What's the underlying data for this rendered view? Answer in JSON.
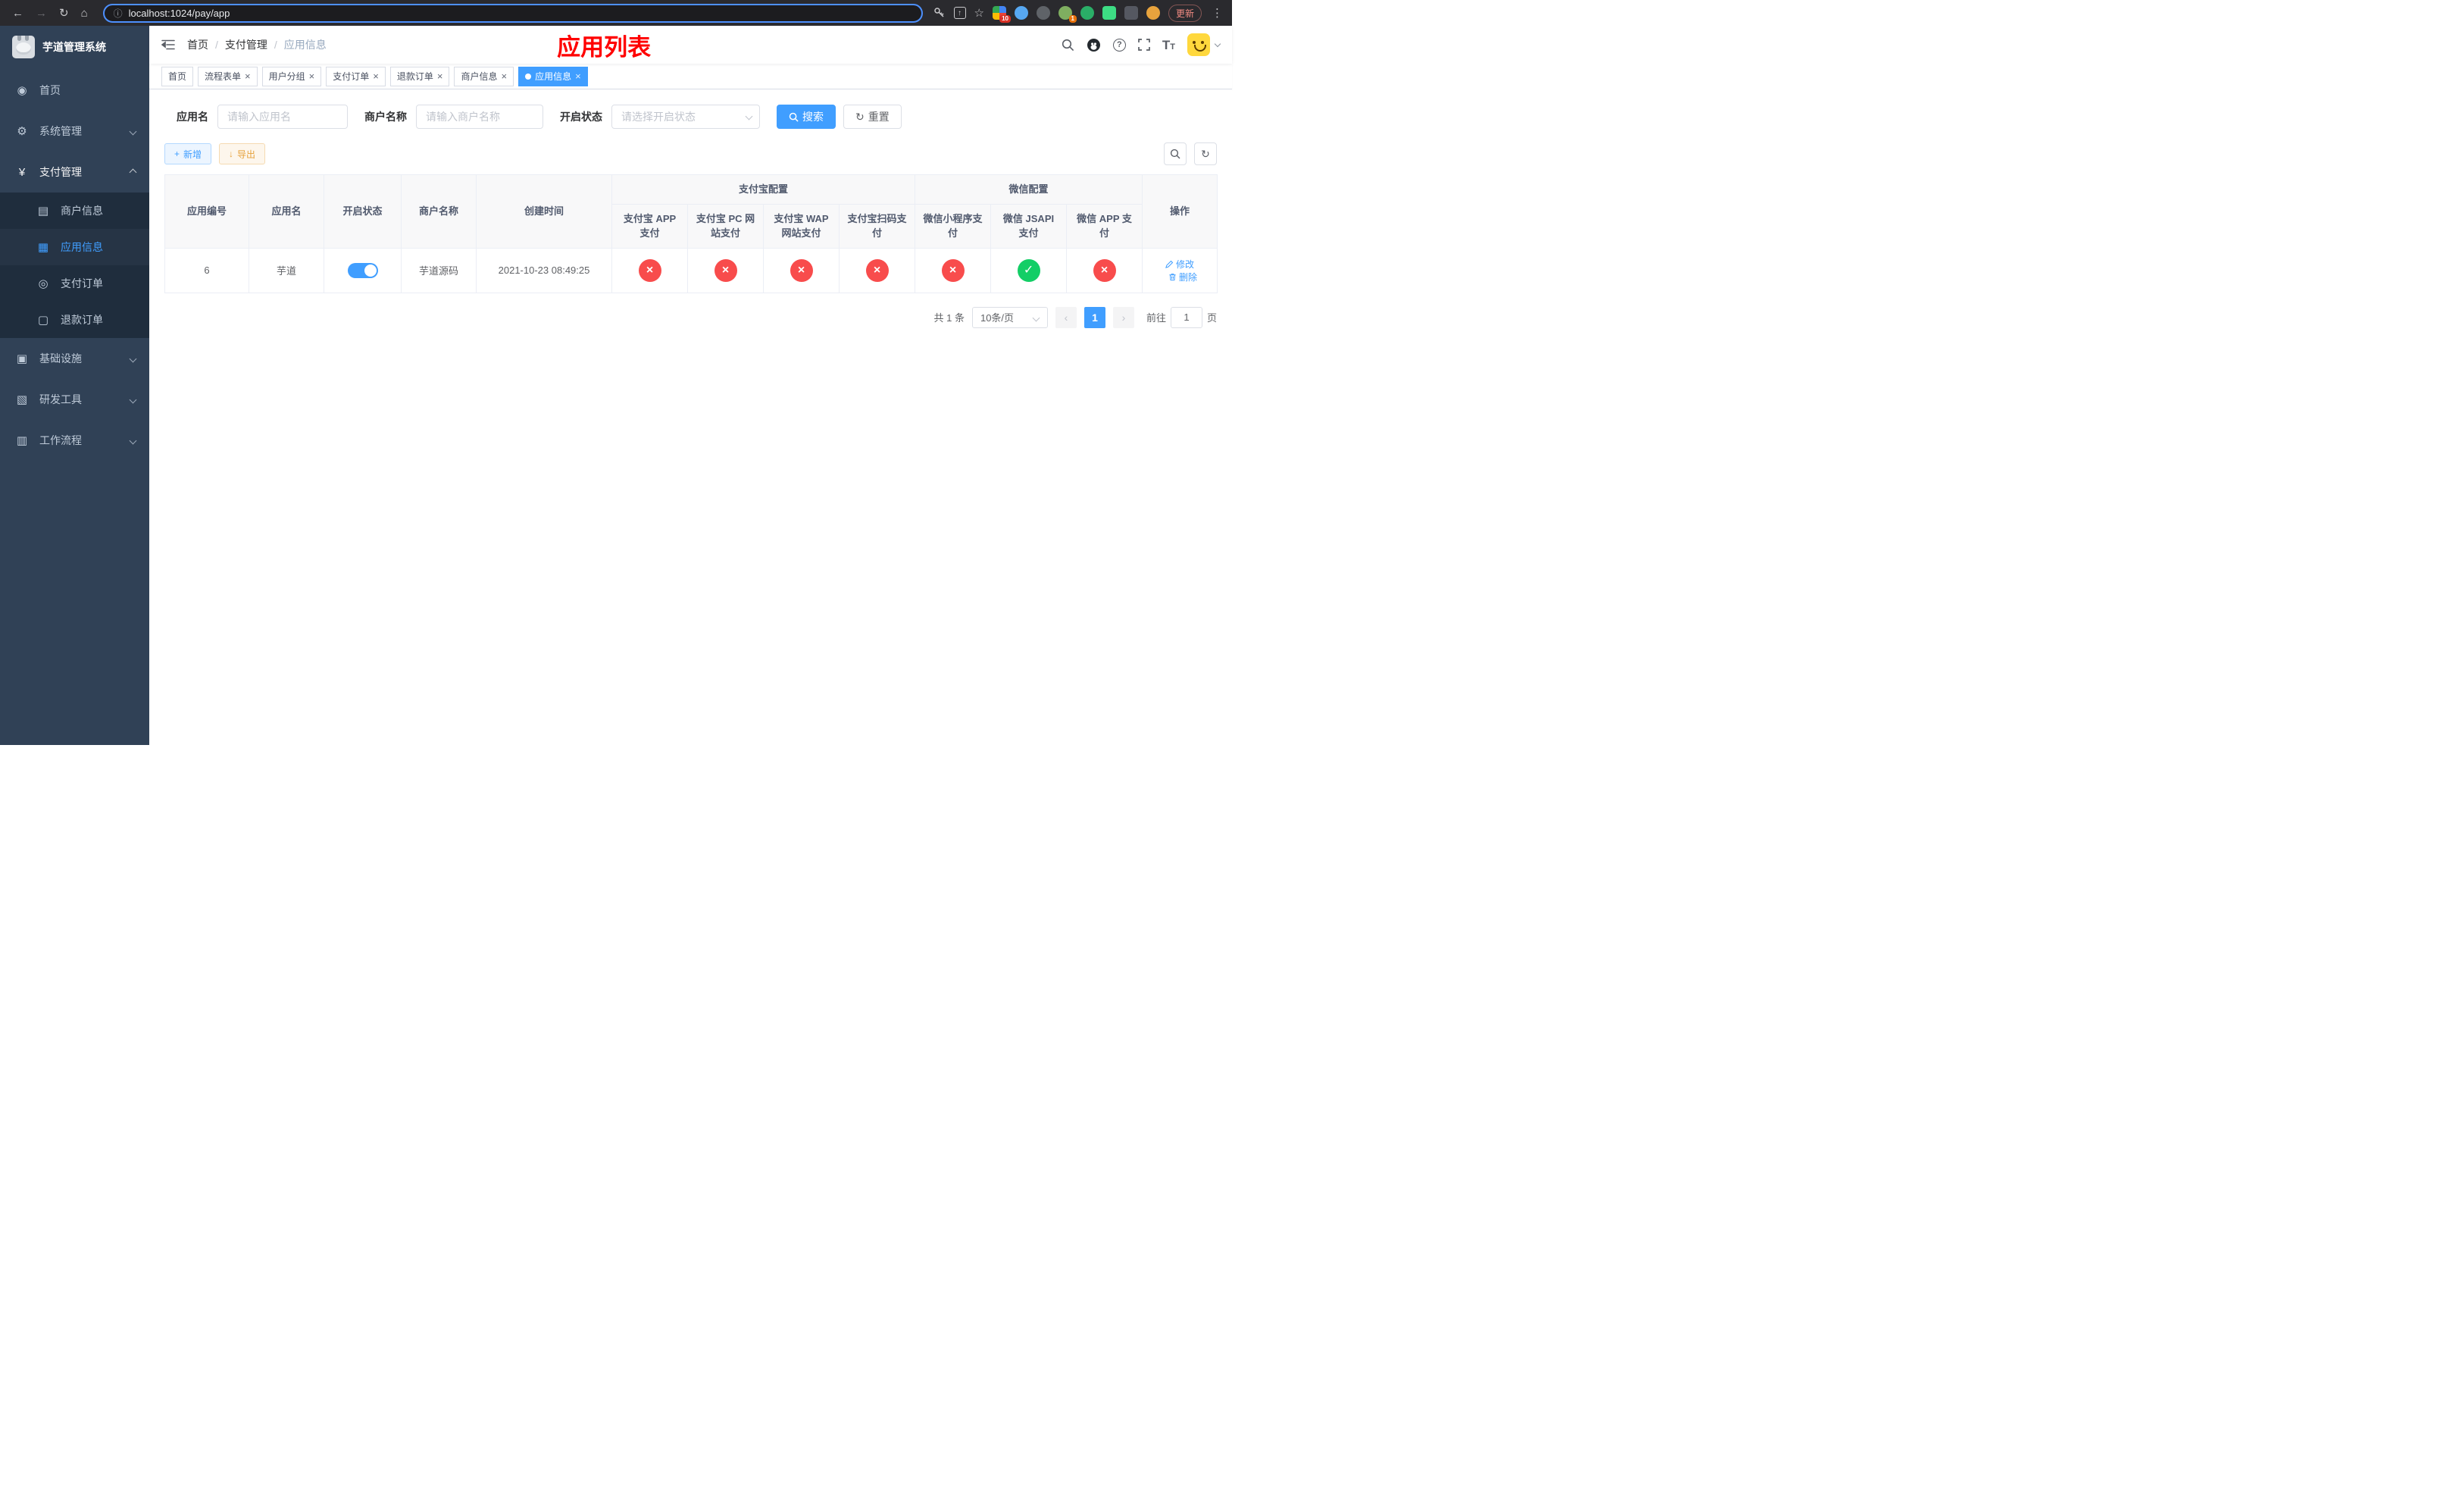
{
  "colors": {
    "primary": "#409eff",
    "success": "#13ce66",
    "danger": "#f84c4c",
    "warning": "#e6a23c",
    "sidebar_bg": "#304156",
    "annotation_red": "#ff0000"
  },
  "icons": {
    "back": "←",
    "forward": "→",
    "reload": "↻",
    "home": "⌂",
    "info": "ⓘ",
    "star": "☆",
    "share": "↑",
    "menu_dots": "⋮",
    "close": "×",
    "dashboard": "◉",
    "system": "⚙",
    "payment": "¥",
    "merchant": "▤",
    "app": "▦",
    "pay_order": "◎",
    "refund_order": "▢",
    "infra": "▣",
    "devtools": "▧",
    "workflow": "▥",
    "plus": "+",
    "download": "↓",
    "question": "?",
    "textsize": "T",
    "prev": "‹",
    "next": "›"
  },
  "browser": {
    "url": "localhost:1024/pay/app",
    "update_label": "更新",
    "ext_badge_red": "10",
    "ext_badge_orange": "1"
  },
  "sidebar": {
    "title": "芋道管理系统",
    "items": {
      "home": "首页",
      "system": "系统管理",
      "payment": "支付管理",
      "merchant_info": "商户信息",
      "app_info": "应用信息",
      "pay_order": "支付订单",
      "refund_order": "退款订单",
      "infra": "基础设施",
      "devtools": "研发工具",
      "workflow": "工作流程"
    }
  },
  "header": {
    "breadcrumb": [
      "首页",
      "支付管理",
      "应用信息"
    ],
    "annotation_title": "应用列表"
  },
  "tabs": [
    {
      "label": "首页"
    },
    {
      "label": "流程表单"
    },
    {
      "label": "用户分组"
    },
    {
      "label": "支付订单"
    },
    {
      "label": "退款订单"
    },
    {
      "label": "商户信息"
    },
    {
      "label": "应用信息"
    }
  ],
  "filters": {
    "app_name_label": "应用名",
    "app_name_placeholder": "请输入应用名",
    "merchant_label": "商户名称",
    "merchant_placeholder": "请输入商户名称",
    "status_label": "开启状态",
    "status_placeholder": "请选择开启状态",
    "search_label": "搜索",
    "reset_label": "重置"
  },
  "toolbar": {
    "add_label": "新增",
    "export_label": "导出"
  },
  "table": {
    "fixed_columns": [
      "应用编号",
      "应用名",
      "开启状态",
      "商户名称",
      "创建时间"
    ],
    "groups": [
      {
        "label": "支付宝配置",
        "columns": [
          "支付宝 APP 支付",
          "支付宝 PC 网站支付",
          "支付宝 WAP 网站支付",
          "支付宝扫码支付"
        ]
      },
      {
        "label": "微信配置",
        "columns": [
          "微信小程序支付",
          "微信 JSAPI 支付",
          "微信 APP 支付"
        ]
      }
    ],
    "action_column": "操作",
    "rows": [
      {
        "id": "6",
        "name": "芋道",
        "enabled": true,
        "merchant": "芋道源码",
        "created_at": "2021-10-23 08:49:25",
        "statuses": [
          "no",
          "no",
          "no",
          "no",
          "no",
          "yes",
          "no"
        ],
        "edit_label": "修改",
        "delete_label": "删除"
      }
    ]
  },
  "pagination": {
    "total_text": "共 1 条",
    "page_size_text": "10条/页",
    "current_page": "1",
    "goto_label": "前往",
    "goto_value": "1",
    "page_unit": "页"
  }
}
